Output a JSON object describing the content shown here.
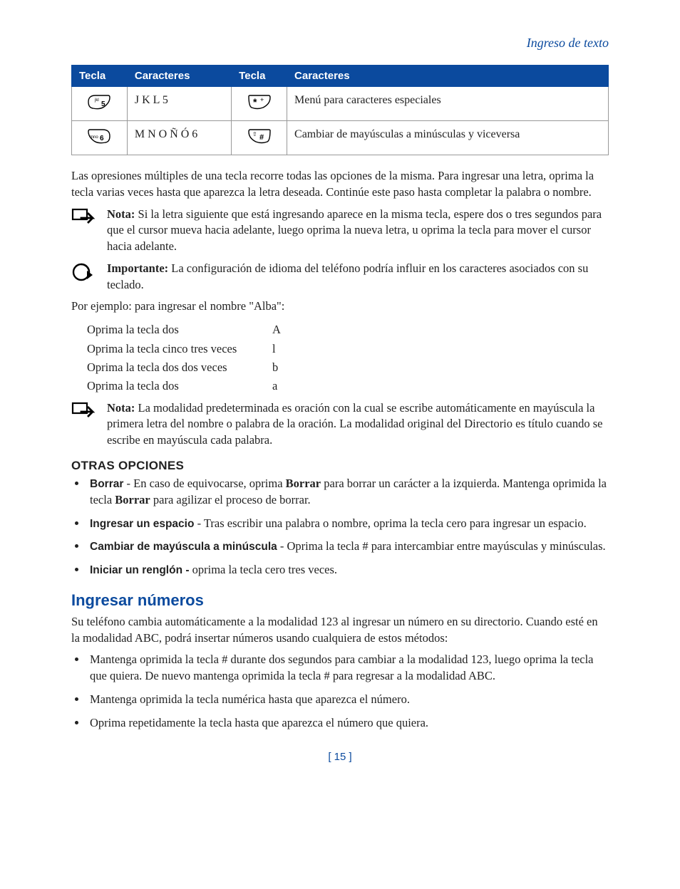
{
  "header": {
    "breadcrumb": "Ingreso de texto"
  },
  "table": {
    "headers": [
      "Tecla",
      "Caracteres",
      "Tecla",
      "Caracteres"
    ],
    "rows": [
      {
        "key1": "5",
        "chars1": "J K L 5",
        "key2": "*",
        "chars2": "Menú para caracteres especiales"
      },
      {
        "key1": "6",
        "chars1": "M N O Ñ Ó 6",
        "key2": "#",
        "chars2": "Cambiar de mayúsculas a minúsculas y viceversa"
      }
    ]
  },
  "para1": "Las opresiones múltiples de una tecla recorre todas las opciones de la misma. Para ingresar una letra, oprima la tecla varias veces hasta que aparezca la letra deseada. Continúe este paso hasta completar la palabra o nombre.",
  "note1": {
    "lead": "Nota:",
    "text": " Si la letra siguiente que está ingresando aparece en la misma tecla, espere dos o tres segundos para que el cursor mueva hacia adelante, luego oprima la nueva letra, u oprima la tecla para mover el cursor hacia adelante."
  },
  "important": {
    "lead": "Importante:",
    "text": " La configuración de idioma del teléfono podría influir en los caracteres asociados con su teclado."
  },
  "example_intro": "Por ejemplo: para ingresar el nombre \"Alba\":",
  "example": [
    {
      "step": "Oprima la tecla dos",
      "result": "A"
    },
    {
      "step": "Oprima la tecla cinco tres veces",
      "result": "l"
    },
    {
      "step": "Oprima la tecla dos dos veces",
      "result": "b"
    },
    {
      "step": "Oprima la tecla dos",
      "result": "a"
    }
  ],
  "note2": {
    "lead": "Nota:",
    "text": " La modalidad predeterminada es oración con la cual se escribe automáticamente en mayúscula la primera letra del nombre o palabra de la oración. La modalidad original del Directorio es título cuando se escribe en mayúscula cada palabra."
  },
  "section_other": {
    "title": "OTRAS OPCIONES",
    "items": [
      {
        "lead": "Borrar",
        "sep": " - ",
        "pre": "En caso de equivocarse, oprima ",
        "mid_b": "Borrar",
        "mid": " para borrar un carácter a la izquierda. Mantenga oprimida la tecla ",
        "mid_b2": "Borrar",
        "post": " para agilizar el proceso de borrar."
      },
      {
        "lead": "Ingresar un espacio",
        "sep": " - ",
        "text": "Tras escribir una palabra o nombre, oprima la tecla cero para ingresar un espacio."
      },
      {
        "lead": "Cambiar de mayúscula a minúscula",
        "sep": " - ",
        "text": "Oprima la tecla # para intercambiar entre mayúsculas y minúsculas."
      },
      {
        "lead": "Iniciar un renglón -",
        "sep": " ",
        "text": "oprima la tecla cero tres veces."
      }
    ]
  },
  "section_numbers": {
    "title": "Ingresar números",
    "intro": "Su teléfono cambia automáticamente a la modalidad 123 al ingresar un número en su directorio. Cuando esté en la modalidad ABC, podrá insertar números usando cualquiera de estos métodos:",
    "items": [
      "Mantenga oprimida la tecla # durante dos segundos para cambiar a la modalidad 123, luego oprima la tecla que quiera. De nuevo mantenga oprimida la tecla # para regresar a la modalidad ABC.",
      "Mantenga oprimida la tecla numérica hasta que aparezca el número.",
      "Oprima repetidamente la tecla hasta que aparezca el número que quiera."
    ]
  },
  "pagenum": "[ 15 ]"
}
